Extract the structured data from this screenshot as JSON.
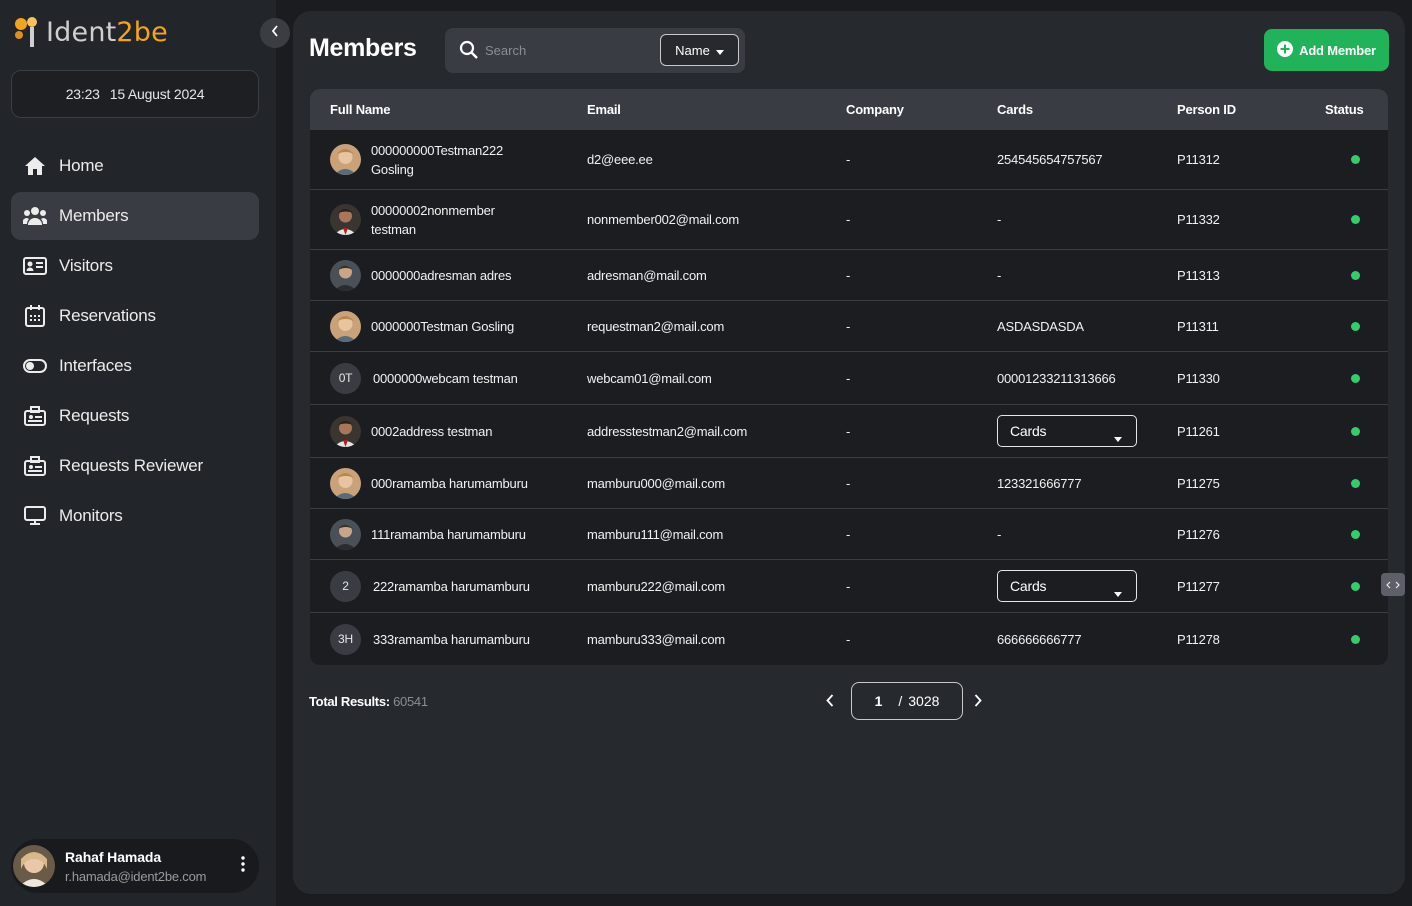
{
  "app": {
    "logo_main": "Ident",
    "logo_accent": "2be"
  },
  "clock": {
    "time": "23:23",
    "date": "15 August 2024"
  },
  "sidebar": {
    "items": [
      {
        "label": "Home",
        "icon": "home-icon"
      },
      {
        "label": "Members",
        "icon": "members-icon",
        "active": true
      },
      {
        "label": "Visitors",
        "icon": "id-card-icon"
      },
      {
        "label": "Reservations",
        "icon": "calendar-icon"
      },
      {
        "label": "Interfaces",
        "icon": "toggle-icon"
      },
      {
        "label": "Requests",
        "icon": "briefcase-icon"
      },
      {
        "label": "Requests Reviewer",
        "icon": "briefcase-icon"
      },
      {
        "label": "Monitors",
        "icon": "monitor-icon"
      }
    ]
  },
  "user": {
    "name": "Rahaf Hamada",
    "email": "r.hamada@ident2be.com"
  },
  "header": {
    "title": "Members",
    "search_placeholder": "Search",
    "filter_label": "Name",
    "add_button": "Add Member"
  },
  "colors": {
    "accent": "#21b35a",
    "status_active": "#2fcf6a",
    "brand": "#f2a51a"
  },
  "table": {
    "columns": [
      "Full Name",
      "Email",
      "Company",
      "Cards",
      "Person ID",
      "Status"
    ],
    "rows": [
      {
        "name": "000000000Testman222 Gosling",
        "email": "d2@eee.ee",
        "company": "-",
        "cards": "254545654757567",
        "person_id": "P11312",
        "status": "active"
      },
      {
        "name": "00000002nonmember testman",
        "email": "nonmember002@mail.com",
        "company": "-",
        "cards": "-",
        "person_id": "P11332",
        "status": "active"
      },
      {
        "name": "0000000adresman adres",
        "email": "adresman@mail.com",
        "company": "-",
        "cards": "-",
        "person_id": "P11313",
        "status": "active"
      },
      {
        "name": "0000000Testman Gosling",
        "email": "requestman2@mail.com",
        "company": "-",
        "cards": "ASDASDASDA",
        "person_id": "P11311",
        "status": "active"
      },
      {
        "initials": "0T",
        "name": "0000000webcam testman",
        "email": "webcam01@mail.com",
        "company": "-",
        "cards": "00001233211313666",
        "person_id": "P11330",
        "status": "active"
      },
      {
        "name": "0002address testman",
        "email": "addresstestman2@mail.com",
        "company": "-",
        "cards": "Cards",
        "person_id": "P11261",
        "status": "active"
      },
      {
        "name": "000ramamba harumamburu",
        "email": "mamburu000@mail.com",
        "company": "-",
        "cards": "123321666777",
        "person_id": "P11275",
        "status": "active"
      },
      {
        "name": "111ramamba harumamburu",
        "email": "mamburu111@mail.com",
        "company": "-",
        "cards": "-",
        "person_id": "P11276",
        "status": "active"
      },
      {
        "initials": "2",
        "name": "222ramamba harumamburu",
        "email": "mamburu222@mail.com",
        "company": "-",
        "cards": "Cards",
        "person_id": "P11277",
        "status": "active"
      },
      {
        "initials": "3H",
        "name": "333ramamba harumamburu",
        "email": "mamburu333@mail.com",
        "company": "-",
        "cards": "666666666777",
        "person_id": "P11278",
        "status": "active"
      }
    ]
  },
  "footer": {
    "total_label": "Total Results:",
    "total_value": "60541",
    "page_current": "1",
    "page_separator": "/",
    "page_total": "3028"
  }
}
